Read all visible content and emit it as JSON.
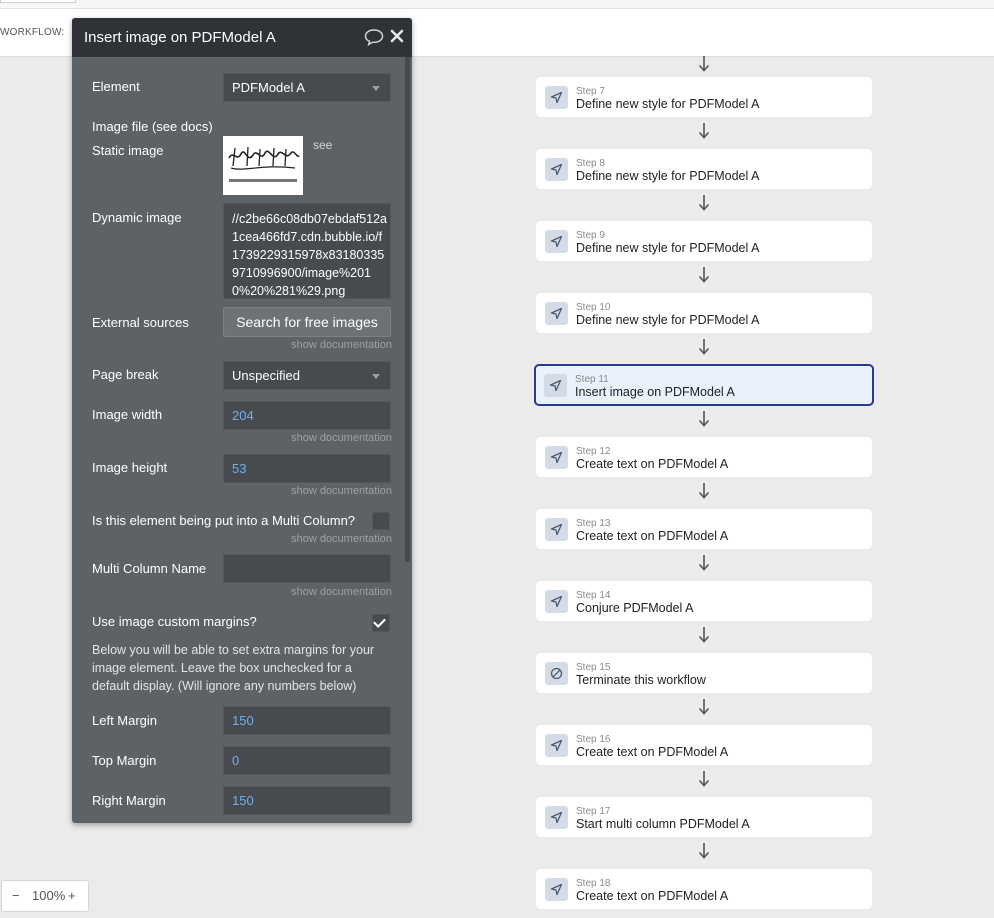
{
  "topbar": {
    "workflow_label": "WORKFLOW:"
  },
  "panel": {
    "title": "Insert image on PDFModel A",
    "element": {
      "label": "Element",
      "value": "PDFModel A"
    },
    "image_file": {
      "label": "Image file (see docs)"
    },
    "static_image": {
      "label": "Static image",
      "see": "see"
    },
    "dynamic_image": {
      "label": "Dynamic image",
      "value": "//c2be66c08db07ebdaf512a1cea466fd7.cdn.bubble.io/f1739229315978x831803359710996900/image%2010%20%281%29.png"
    },
    "external_sources": {
      "label": "External sources",
      "button": "Search for free images",
      "doc": "show documentation"
    },
    "page_break": {
      "label": "Page break",
      "value": "Unspecified"
    },
    "image_width": {
      "label": "Image width",
      "value": "204",
      "doc": "show documentation"
    },
    "image_height": {
      "label": "Image height",
      "value": "53",
      "doc": "show documentation"
    },
    "multi_column": {
      "label": "Is this element being put into a Multi Column?",
      "doc": "show documentation"
    },
    "multi_column_name": {
      "label": "Multi Column Name",
      "value": "",
      "doc": "show documentation"
    },
    "custom_margins": {
      "label": "Use image custom margins?",
      "checked": true,
      "help": "Below you will be able to set extra margins for your image element. Leave the box unchecked for a default display. (Will ignore any numbers below)"
    },
    "left_margin": {
      "label": "Left Margin",
      "value": "150"
    },
    "top_margin": {
      "label": "Top Margin",
      "value": "0"
    },
    "right_margin": {
      "label": "Right Margin",
      "value": "150"
    }
  },
  "steps": [
    {
      "num": "Step 7",
      "name": "Define new style for PDFModel A",
      "icon": "cursor-icon"
    },
    {
      "num": "Step 8",
      "name": "Define new style for PDFModel A",
      "icon": "cursor-icon"
    },
    {
      "num": "Step 9",
      "name": "Define new style for PDFModel A",
      "icon": "cursor-icon"
    },
    {
      "num": "Step 10",
      "name": "Define new style for PDFModel A",
      "icon": "cursor-icon"
    },
    {
      "num": "Step 11",
      "name": "Insert image on PDFModel A",
      "icon": "cursor-icon",
      "selected": true
    },
    {
      "num": "Step 12",
      "name": "Create text on PDFModel A",
      "icon": "cursor-icon"
    },
    {
      "num": "Step 13",
      "name": "Create text on PDFModel A",
      "icon": "cursor-icon"
    },
    {
      "num": "Step 14",
      "name": "Conjure PDFModel A",
      "icon": "cursor-icon"
    },
    {
      "num": "Step 15",
      "name": "Terminate this workflow",
      "icon": "stop-icon"
    },
    {
      "num": "Step 16",
      "name": "Create text on PDFModel A",
      "icon": "cursor-icon"
    },
    {
      "num": "Step 17",
      "name": "Start multi column PDFModel A",
      "icon": "cursor-icon"
    },
    {
      "num": "Step 18",
      "name": "Create text on PDFModel A",
      "icon": "cursor-icon"
    }
  ],
  "zoom": {
    "minus": "−",
    "value": "100%",
    "plus": "+"
  },
  "colors": {
    "panel_bg": "#5d6266",
    "panel_header": "#2f3337",
    "selected_border": "#2b3a8f",
    "selected_bg": "#e9f1fd",
    "number_value": "#6fb0ef"
  }
}
